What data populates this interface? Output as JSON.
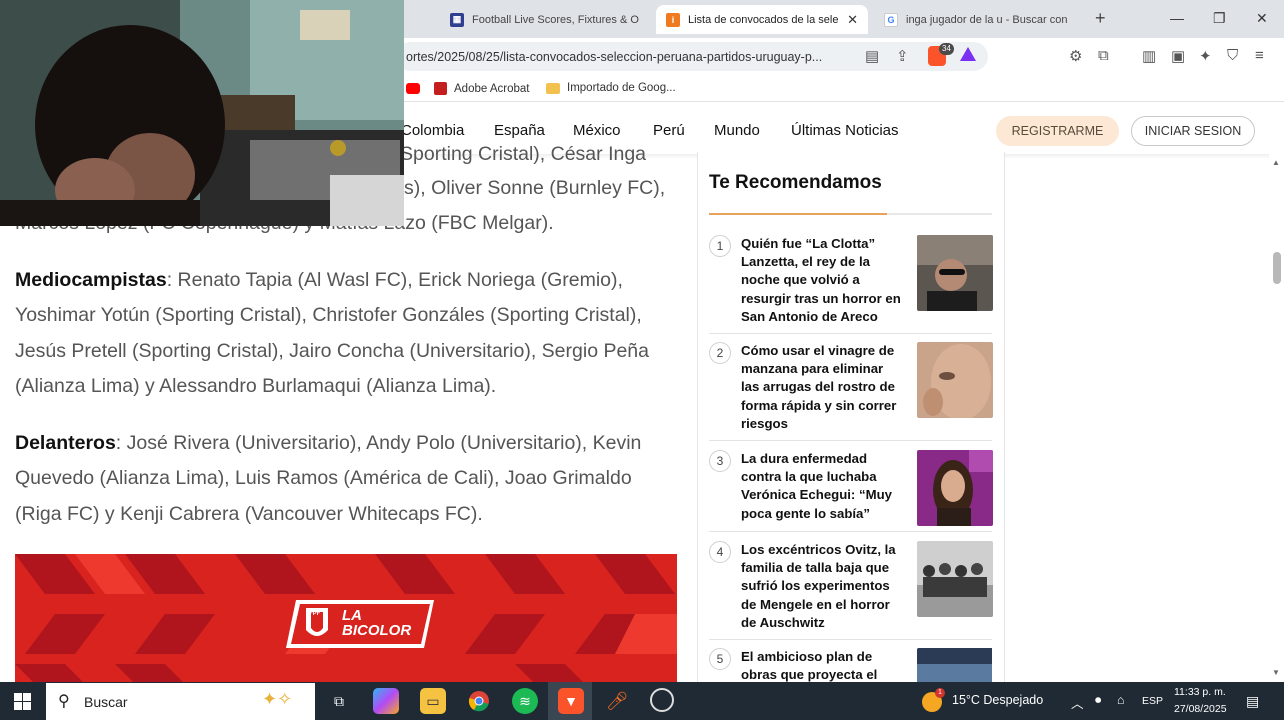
{
  "browser": {
    "tabs": [
      {
        "label": "Football Live Scores, Fixtures & O",
        "favicon": "football-favicon"
      },
      {
        "label": "Lista de convocados de la sele",
        "favicon": "infobae-favicon",
        "active": true
      },
      {
        "label": "inga jugador de la u - Buscar con",
        "favicon": "google-favicon"
      }
    ],
    "new_tab_glyph": "+",
    "url": "ortes/2025/08/25/lista-convocados-seleccion-peruana-partidos-uruguay-p...",
    "brave_badge": "34",
    "bookmarks": [
      {
        "label": "Adobe Acrobat",
        "icon": "acrobat-icon"
      },
      {
        "label": "Importado de Goog...",
        "icon": "folder-icon"
      }
    ]
  },
  "site_nav": {
    "items": [
      "Colombia",
      "España",
      "México",
      "Perú",
      "Mundo",
      "Últimas Noticias"
    ],
    "register": "REGISTRARME",
    "login": "INICIAR SESION"
  },
  "article": {
    "top_lines": [
      "Sporting Cristal), César Inga",
      "s), Oliver Sonne (Burnley FC),",
      "Marcos López (FC Copenhague) y Matías Lazo (FBC Melgar)."
    ],
    "midfielders_label": "Mediocampistas",
    "midfielders_text": ": Renato Tapia (Al Wasl FC), Erick Noriega (Gremio), Yoshimar Yotún (Sporting Cristal), Christofer Gonzáles (Sporting Cristal), Jesús Pretell (Sporting Cristal), Jairo Concha (Universitario), Sergio Peña (Alianza Lima) y Alessandro Burlamaqui (Alianza Lima).",
    "forwards_label": "Delanteros",
    "forwards_text": ": José Rivera (Universitario), Andy Polo (Universitario), Kevin Quevedo (Alianza Lima), Luis Ramos (América de Cali), Joao Grimaldo (Riga FC) y Kenji Cabrera (Vancouver Whitecaps FC).",
    "banner_logo_text": "LA BICOLOR",
    "banner_crest_text": "FPF"
  },
  "recommendations": {
    "title": "Te Recomendamos",
    "items": [
      {
        "num": "1",
        "text": "Quién fue “La Clotta” Lanzetta, el rey de la noche que volvió a resurgir tras un horror en San Antonio de Areco"
      },
      {
        "num": "2",
        "text": "Cómo usar el vinagre de manzana para eliminar las arrugas del rostro de forma rápida y sin correr riesgos"
      },
      {
        "num": "3",
        "text": "La dura enfermedad contra la que luchaba Verónica Echegui: “Muy poca gente lo sabía”"
      },
      {
        "num": "4",
        "text": "Los excéntricos Ovitz, la familia de talla baja que sufrió los experimentos de Mengele en el horror de Auschwitz"
      },
      {
        "num": "5",
        "text": "El ambicioso plan de obras que proyecta el"
      }
    ]
  },
  "taskbar": {
    "search_placeholder": "Buscar",
    "weather": "15°C  Despejado",
    "weather_badge": "1",
    "lang": "ESP",
    "time": "11:33 p. m.",
    "date": "27/08/2025"
  },
  "colors": {
    "accent_orange": "#e8a35a",
    "register_bg": "#fde8d6",
    "banner_red": "#d8231f",
    "taskbar": "#1f2a34"
  }
}
